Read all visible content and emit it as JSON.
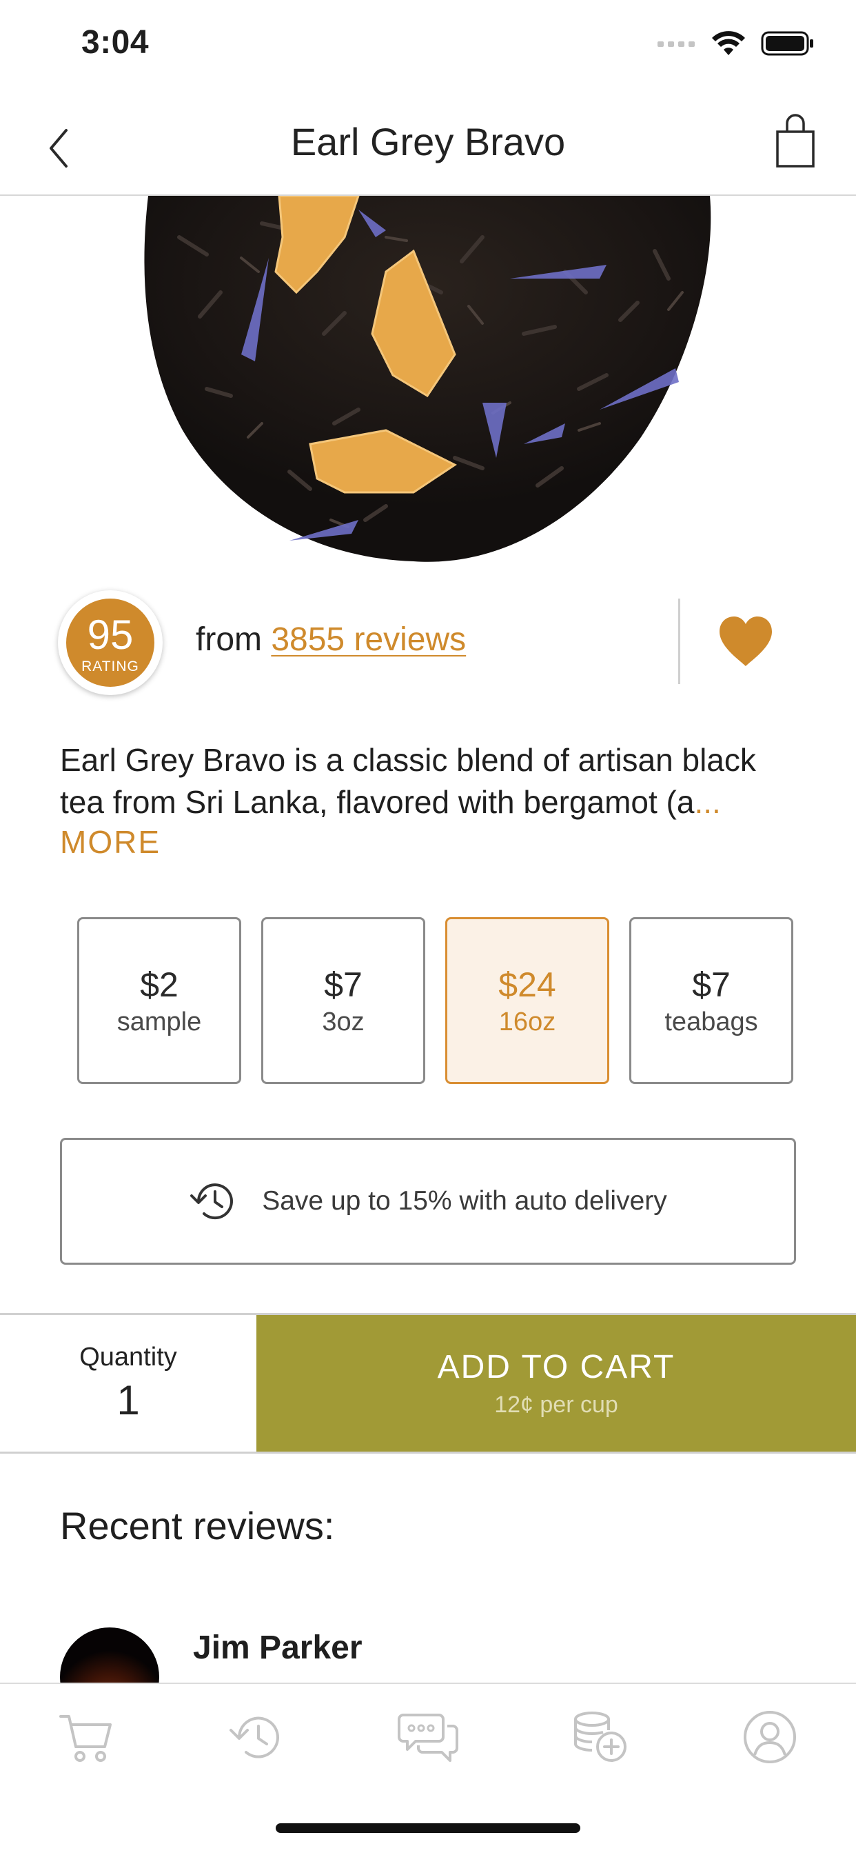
{
  "status_bar": {
    "time": "3:04"
  },
  "header": {
    "title": "Earl Grey Bravo"
  },
  "rating": {
    "value": "95",
    "caption": "RATING",
    "from_text": "from ",
    "reviews_link": "3855 reviews",
    "favorited": true
  },
  "description": {
    "text": "Earl Grey Bravo is a classic blend of artisan black tea from Sri Lanka, flavored with bergamot (a",
    "ellipsis": "...",
    "more_label": "MORE"
  },
  "sizes": [
    {
      "price": "$2",
      "label": "sample",
      "selected": false
    },
    {
      "price": "$7",
      "label": "3oz",
      "selected": false
    },
    {
      "price": "$24",
      "label": "16oz",
      "selected": true
    },
    {
      "price": "$7",
      "label": "teabags",
      "selected": false
    }
  ],
  "auto_delivery": {
    "label": "Save up to 15% with auto delivery"
  },
  "cart": {
    "quantity_label": "Quantity",
    "quantity_value": "1",
    "add_label": "ADD TO CART",
    "per_cup": "12¢ per cup"
  },
  "reviews": {
    "title": "Recent reviews:",
    "items": [
      {
        "name": "Jim Parker"
      }
    ]
  },
  "tab_bar": {
    "items": [
      "cart-icon",
      "history-icon",
      "chat-icon",
      "rewards-icon",
      "profile-icon"
    ]
  },
  "colors": {
    "accent": "#cf8a2c",
    "cart_button": "#a19a36",
    "selected_bg": "#fbf1e6"
  }
}
